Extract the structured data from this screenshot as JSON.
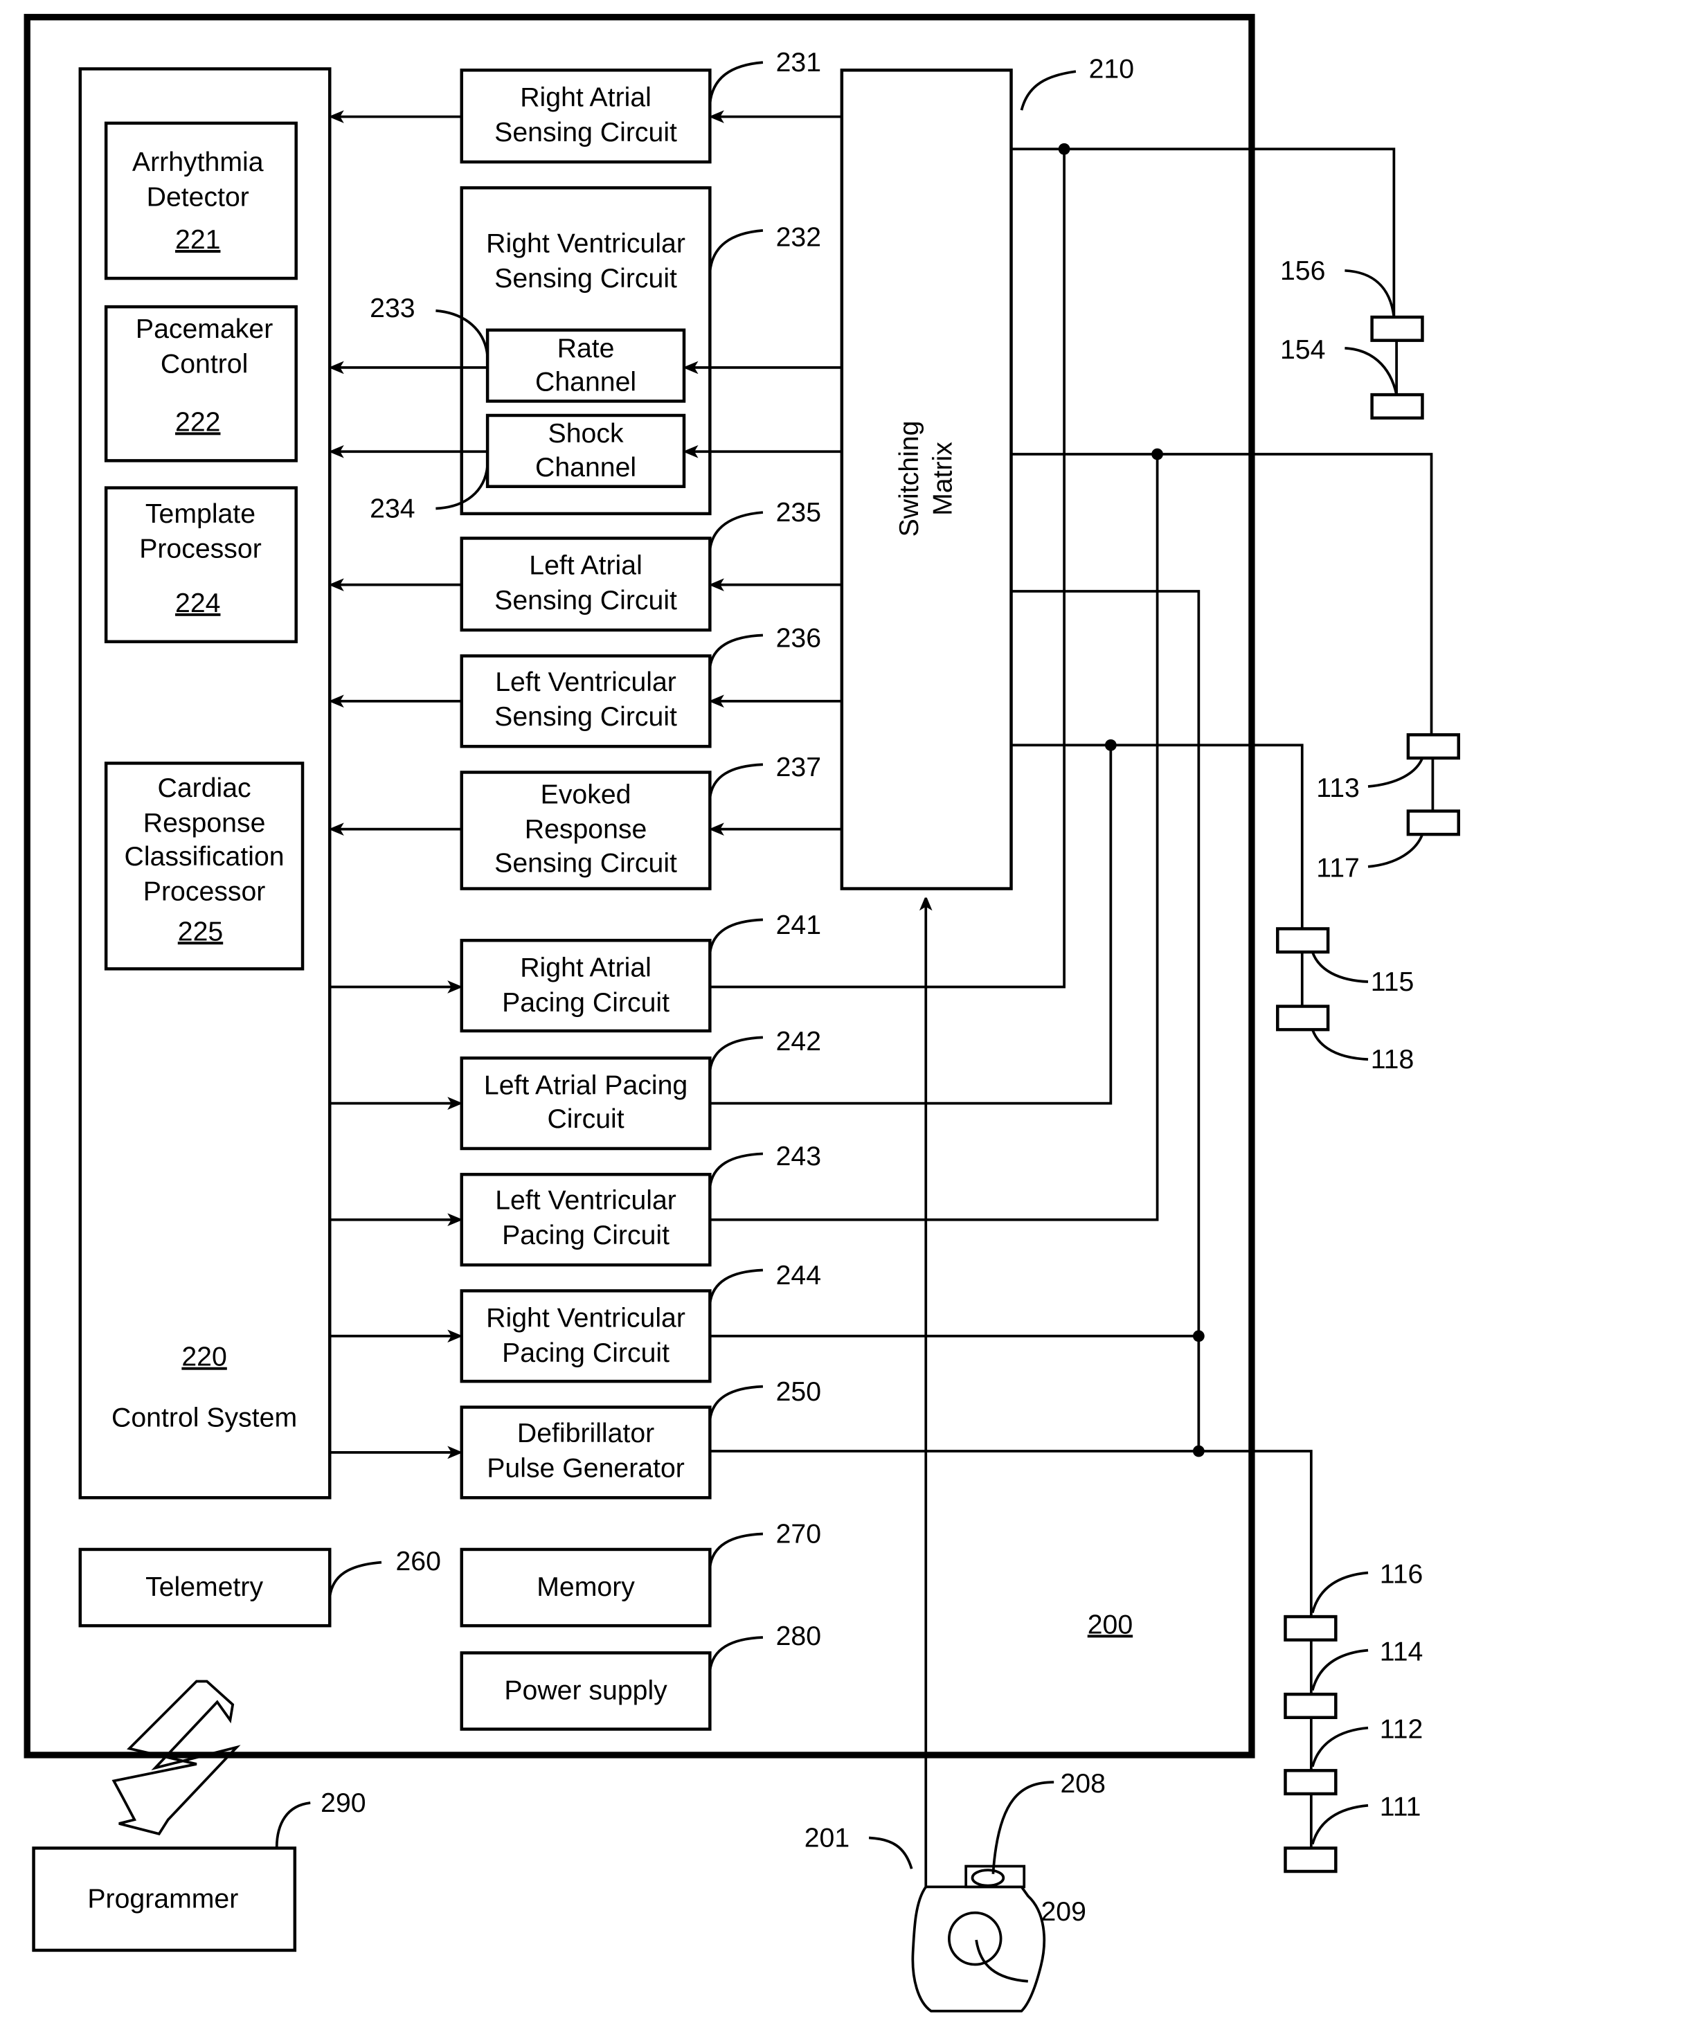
{
  "device": {
    "ref": "200",
    "colors": {
      "line": "#000000",
      "background": "#ffffff"
    }
  },
  "control_system": {
    "ref": "220",
    "label": "Control System",
    "modules": [
      {
        "lines": [
          "Arrhythmia",
          "Detector"
        ],
        "ref": "221"
      },
      {
        "lines": [
          "Pacemaker",
          "Control"
        ],
        "ref": "222"
      },
      {
        "lines": [
          "Template",
          "Processor"
        ],
        "ref": "224"
      },
      {
        "lines": [
          "Cardiac",
          "Response",
          "Classification",
          "Processor"
        ],
        "ref": "225"
      }
    ]
  },
  "switching_matrix": {
    "lines": [
      "Switching",
      "Matrix"
    ],
    "ref": "210"
  },
  "sensing_circuits": [
    {
      "lines": [
        "Right Atrial",
        "Sensing Circuit"
      ],
      "ref": "231"
    },
    {
      "lines": [
        "Right Ventricular",
        "Sensing Circuit"
      ],
      "ref": "232",
      "channels": [
        {
          "lines": [
            "Rate",
            "Channel"
          ],
          "ref": "233"
        },
        {
          "lines": [
            "Shock",
            "Channel"
          ],
          "ref": "234"
        }
      ]
    },
    {
      "lines": [
        "Left Atrial",
        "Sensing Circuit"
      ],
      "ref": "235"
    },
    {
      "lines": [
        "Left Ventricular",
        "Sensing Circuit"
      ],
      "ref": "236"
    },
    {
      "lines": [
        "Evoked",
        "Response",
        "Sensing Circuit"
      ],
      "ref": "237"
    }
  ],
  "pacing_circuits": [
    {
      "lines": [
        "Right Atrial",
        "Pacing Circuit"
      ],
      "ref": "241"
    },
    {
      "lines": [
        "Left Atrial Pacing",
        "Circuit"
      ],
      "ref": "242"
    },
    {
      "lines": [
        "Left Ventricular",
        "Pacing Circuit"
      ],
      "ref": "243"
    },
    {
      "lines": [
        "Right Ventricular",
        "Pacing Circuit"
      ],
      "ref": "244"
    },
    {
      "lines": [
        "Defibrillator",
        "Pulse Generator"
      ],
      "ref": "250"
    }
  ],
  "other_blocks": {
    "telemetry": {
      "label": "Telemetry",
      "ref": "260"
    },
    "memory": {
      "label": "Memory",
      "ref": "270"
    },
    "power_supply": {
      "label": "Power supply",
      "ref": "280"
    },
    "programmer": {
      "label": "Programmer",
      "ref": "290"
    }
  },
  "housing": {
    "ref": "201",
    "header_ref": "208",
    "can_ref": "209"
  },
  "electrodes": {
    "lead_a": [
      "156",
      "154"
    ],
    "lead_b": [
      "113",
      "117"
    ],
    "lead_c": [
      "115",
      "118"
    ],
    "lead_d": [
      "116",
      "114",
      "112",
      "111"
    ]
  }
}
